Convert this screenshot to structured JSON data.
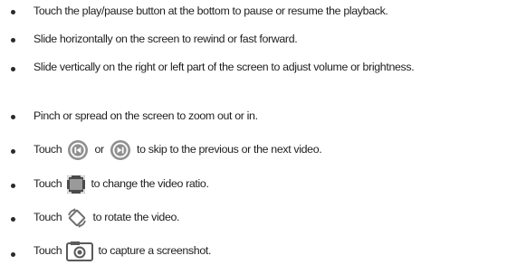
{
  "instructions": [
    {
      "text": "Touch the play/pause button at the bottom to pause or resume the playback."
    },
    {
      "text": "Slide horizontally on the screen to rewind or fast forward."
    },
    {
      "text": "Slide vertically on the right or left part of the screen to adjust volume or brightness."
    },
    {
      "text": "Pinch or spread on the screen to zoom out or in."
    },
    {
      "before": "Touch",
      "middle": "or",
      "after": "to skip to the previous or the next video.",
      "icons": [
        "skip-previous-icon",
        "skip-next-icon"
      ]
    },
    {
      "before": "Touch",
      "after": "to change the video ratio.",
      "icons": [
        "video-ratio-icon"
      ]
    },
    {
      "before": "Touch",
      "after": "to rotate the video.",
      "icons": [
        "rotate-icon"
      ]
    },
    {
      "before": "Touch",
      "after": "to capture a screenshot.",
      "icons": [
        "screenshot-camera-icon"
      ]
    }
  ],
  "colors": {
    "text": "#1e1e1e",
    "icon_fill": "#8f8f8f",
    "icon_dark": "#4a4a4a"
  }
}
